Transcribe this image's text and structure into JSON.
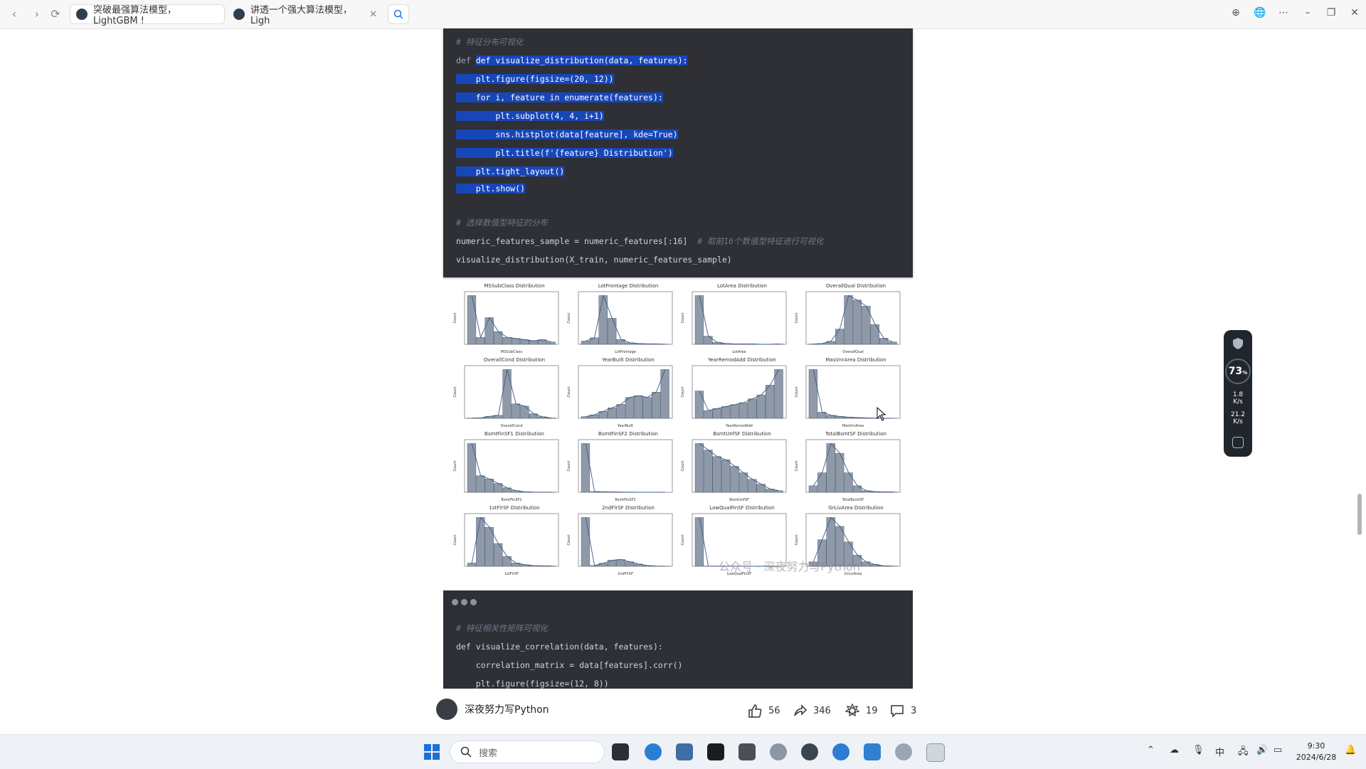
{
  "browser": {
    "tabs": [
      {
        "title": "突破最强算法模型，LightGBM !",
        "active": true
      },
      {
        "title": "讲透一个强大算法模型，Ligh",
        "active": false
      }
    ]
  },
  "code1": {
    "comment_title": "# 特征分布可视化",
    "lines": [
      "def visualize_distribution(data, features):",
      "    plt.figure(figsize=(20, 12))",
      "    for i, feature in enumerate(features):",
      "        plt.subplot(4, 4, i+1)",
      "        sns.histplot(data[feature], kde=True)",
      "        plt.title(f'{feature} Distribution')",
      "    plt.tight_layout()",
      "    plt.show()"
    ],
    "comment_sample": "# 选择数值型特征的分布",
    "sample_line": "numeric_features_sample = numeric_features[:16]",
    "sample_comment": "# 取前16个数值型特征进行可视化",
    "call_line": "visualize_distribution(X_train, numeric_features_sample)"
  },
  "chart_data": [
    {
      "type": "bar",
      "title": "MSSubClass Distribution",
      "xlabel": "MSSubClass",
      "ylabel": "Count",
      "values": [
        420,
        60,
        230,
        110,
        60,
        50,
        40,
        30,
        40,
        20
      ]
    },
    {
      "type": "bar",
      "title": "LotFrontage Distribution",
      "xlabel": "LotFrontage",
      "ylabel": "Count",
      "values": [
        20,
        40,
        300,
        160,
        30,
        10,
        5,
        3,
        2,
        1
      ]
    },
    {
      "type": "bar",
      "title": "LotArea Distribution",
      "xlabel": "LotArea",
      "ylabel": "Count",
      "values": [
        120,
        20,
        5,
        2,
        1,
        1,
        1,
        0,
        0,
        1
      ]
    },
    {
      "type": "bar",
      "title": "OverallQual Distribution",
      "xlabel": "OverallQual",
      "ylabel": "Count",
      "values": [
        2,
        5,
        20,
        100,
        320,
        290,
        250,
        130,
        40,
        15
      ]
    },
    {
      "type": "bar",
      "title": "OverallCond Distribution",
      "xlabel": "OverallCond",
      "ylabel": "Count",
      "values": [
        3,
        5,
        25,
        40,
        640,
        190,
        160,
        60,
        20,
        5
      ]
    },
    {
      "type": "bar",
      "title": "YearBuilt Distribution",
      "xlabel": "YearBuilt",
      "ylabel": "Count",
      "values": [
        10,
        20,
        40,
        60,
        80,
        120,
        130,
        120,
        150,
        280
      ]
    },
    {
      "type": "bar",
      "title": "YearRemodAdd Distribution",
      "xlabel": "YearRemodAdd",
      "ylabel": "Count",
      "values": [
        140,
        40,
        50,
        60,
        70,
        80,
        100,
        120,
        170,
        250
      ]
    },
    {
      "type": "bar",
      "title": "MasVnrArea Distribution",
      "xlabel": "MasVnrArea",
      "ylabel": "Count",
      "values": [
        640,
        80,
        40,
        25,
        15,
        10,
        5,
        3,
        2,
        1
      ]
    },
    {
      "type": "bar",
      "title": "BsmtFinSF1 Distribution",
      "xlabel": "BsmtFinSF1",
      "ylabel": "Count",
      "values": [
        440,
        150,
        120,
        80,
        40,
        15,
        5,
        2,
        1,
        1
      ]
    },
    {
      "type": "bar",
      "title": "BsmtFinSF2 Distribution",
      "xlabel": "BsmtFinSF2",
      "ylabel": "Count",
      "values": [
        1000,
        15,
        10,
        8,
        5,
        3,
        2,
        1,
        1,
        0
      ]
    },
    {
      "type": "bar",
      "title": "BsmtUnfSF Distribution",
      "xlabel": "BsmtUnfSF",
      "ylabel": "Count",
      "values": [
        150,
        130,
        110,
        100,
        80,
        60,
        40,
        25,
        10,
        5
      ]
    },
    {
      "type": "bar",
      "title": "TotalBsmtSF Distribution",
      "xlabel": "TotalBsmtSF",
      "ylabel": "Count",
      "values": [
        20,
        60,
        150,
        120,
        60,
        20,
        5,
        2,
        1,
        1
      ]
    },
    {
      "type": "bar",
      "title": "1stFlrSF Distribution",
      "xlabel": "1stFlrSF",
      "ylabel": "Count",
      "values": [
        10,
        150,
        120,
        70,
        30,
        10,
        5,
        2,
        1,
        1
      ]
    },
    {
      "type": "bar",
      "title": "2ndFlrSF Distribution",
      "xlabel": "2ndFlrSF",
      "ylabel": "Count",
      "values": [
        650,
        10,
        40,
        80,
        90,
        60,
        30,
        10,
        3,
        1
      ]
    },
    {
      "type": "bar",
      "title": "LowQualFinSF Distribution",
      "xlabel": "LowQualFinSF",
      "ylabel": "Count",
      "values": [
        1000,
        5,
        3,
        2,
        1,
        1,
        1,
        0,
        0,
        0
      ]
    },
    {
      "type": "bar",
      "title": "GrLivArea Distribution",
      "xlabel": "GrLivArea",
      "ylabel": "Count",
      "values": [
        20,
        120,
        220,
        180,
        110,
        50,
        20,
        8,
        2,
        1
      ]
    }
  ],
  "watermark": "公众号 · 深夜努力写Python",
  "code2": {
    "comment_title": "# 特征相关性矩阵可视化",
    "lines": [
      "def visualize_correlation(data, features):",
      "    correlation_matrix = data[features].corr()",
      "    plt.figure(figsize=(12, 8))"
    ]
  },
  "author": {
    "name": "深夜努力写Python"
  },
  "stats": {
    "likes": "56",
    "shares": "346",
    "favorites": "19",
    "comments": "3"
  },
  "widget": {
    "percent": "73",
    "up": "1.8",
    "up_unit": "K/s",
    "down": "21.2",
    "down_unit": "K/s"
  },
  "taskbar": {
    "search_placeholder": "搜索",
    "ime": "中",
    "time": "9:30",
    "date": "2024/6/28"
  },
  "colors": {
    "code_bg": "#2e3036",
    "highlight": "#1746b8",
    "bar_fill": "#8e9aa9"
  }
}
